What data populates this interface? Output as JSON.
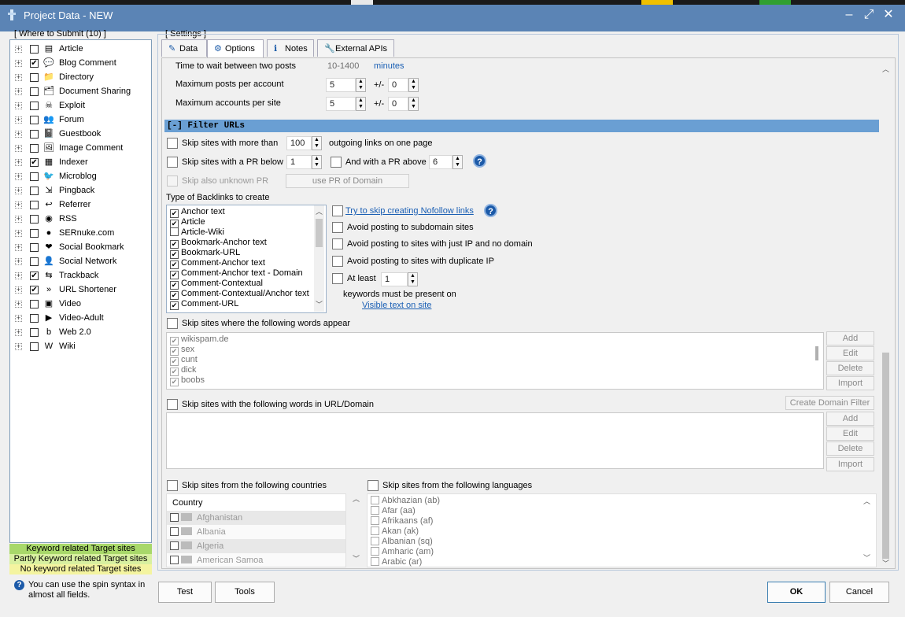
{
  "window": {
    "title": "Project Data - NEW"
  },
  "left": {
    "title": "[ Where to Submit  (10) ]",
    "items": [
      {
        "label": "Article",
        "checked": false,
        "icon": "article-icon",
        "glyph": "▤"
      },
      {
        "label": "Blog Comment",
        "checked": true,
        "icon": "blog-comment-icon",
        "glyph": "💬"
      },
      {
        "label": "Directory",
        "checked": false,
        "icon": "directory-icon",
        "glyph": "📁"
      },
      {
        "label": "Document Sharing",
        "checked": false,
        "icon": "document-sharing-icon",
        "glyph": "🗂"
      },
      {
        "label": "Exploit",
        "checked": false,
        "icon": "exploit-icon",
        "glyph": "☠"
      },
      {
        "label": "Forum",
        "checked": false,
        "icon": "forum-icon",
        "glyph": "👥"
      },
      {
        "label": "Guestbook",
        "checked": false,
        "icon": "guestbook-icon",
        "glyph": "📓"
      },
      {
        "label": "Image Comment",
        "checked": false,
        "icon": "image-comment-icon",
        "glyph": "🖼"
      },
      {
        "label": "Indexer",
        "checked": true,
        "icon": "indexer-icon",
        "glyph": "▦"
      },
      {
        "label": "Microblog",
        "checked": false,
        "icon": "microblog-icon",
        "glyph": "🐦"
      },
      {
        "label": "Pingback",
        "checked": false,
        "icon": "pingback-icon",
        "glyph": "⇲"
      },
      {
        "label": "Referrer",
        "checked": false,
        "icon": "referrer-icon",
        "glyph": "↩"
      },
      {
        "label": "RSS",
        "checked": false,
        "icon": "rss-icon",
        "glyph": "◉"
      },
      {
        "label": "SERnuke.com",
        "checked": false,
        "icon": "sernuke-icon",
        "glyph": "●"
      },
      {
        "label": "Social Bookmark",
        "checked": false,
        "icon": "social-bookmark-icon",
        "glyph": "❤"
      },
      {
        "label": "Social Network",
        "checked": false,
        "icon": "social-network-icon",
        "glyph": "👤"
      },
      {
        "label": "Trackback",
        "checked": true,
        "icon": "trackback-icon",
        "glyph": "⇆"
      },
      {
        "label": "URL Shortener",
        "checked": true,
        "icon": "url-shortener-icon",
        "glyph": "»"
      },
      {
        "label": "Video",
        "checked": false,
        "icon": "video-icon",
        "glyph": "▣"
      },
      {
        "label": "Video-Adult",
        "checked": false,
        "icon": "video-adult-icon",
        "glyph": "▶"
      },
      {
        "label": "Web 2.0",
        "checked": false,
        "icon": "web20-icon",
        "glyph": "b"
      },
      {
        "label": "Wiki",
        "checked": false,
        "icon": "wiki-icon",
        "glyph": "W"
      }
    ],
    "legend": [
      {
        "label": "Keyword related Target sites",
        "color": "#a8d86a"
      },
      {
        "label": "Partly Keyword related Target sites",
        "color": "#d8f0a0"
      },
      {
        "label": "No keyword related Target sites",
        "color": "#f4f4a0"
      }
    ],
    "help_text": "You can use the spin syntax in almost all fields."
  },
  "settings": {
    "title": "[ Settings ]",
    "tabs": [
      {
        "label": "Data",
        "icon": "pencil-icon",
        "glyph": "✎"
      },
      {
        "label": "Options",
        "icon": "gear-icon",
        "glyph": "⚙"
      },
      {
        "label": "Notes",
        "icon": "notes-icon",
        "glyph": "ℹ"
      },
      {
        "label": "External APIs",
        "icon": "wrench-icon",
        "glyph": "🔧"
      }
    ],
    "active_tab": "Options"
  },
  "posting": {
    "wait_label": "Time to wait between two posts",
    "wait_value": "10-1400",
    "wait_unit": "minutes",
    "max_posts_label": "Maximum posts per account",
    "max_posts_value": "5",
    "max_posts_pm": "+/-",
    "max_posts_pm_value": "0",
    "max_accounts_label": "Maximum accounts per site",
    "max_accounts_value": "5",
    "max_accounts_pm": "+/-",
    "max_accounts_pm_value": "0"
  },
  "filter": {
    "header": "[-] Filter URLs",
    "skip_more_label": "Skip sites with more than",
    "skip_more_value": "100",
    "skip_more_suffix": "outgoing links on one page",
    "skip_pr_label": "Skip sites with a PR below",
    "skip_pr_value": "1",
    "pr_above_label": "And with a PR above",
    "pr_above_value": "6",
    "skip_unknown_label": "Skip also unknown PR",
    "use_pr_domain_label": "use PR of Domain",
    "backlinks_label": "Type of Backlinks to create",
    "backlinks": [
      {
        "label": "Anchor text",
        "checked": true
      },
      {
        "label": "Article",
        "checked": true
      },
      {
        "label": "Article-Wiki",
        "checked": false
      },
      {
        "label": "Bookmark-Anchor text",
        "checked": true
      },
      {
        "label": "Bookmark-URL",
        "checked": true
      },
      {
        "label": "Comment-Anchor text",
        "checked": true
      },
      {
        "label": "Comment-Anchor text - Domain",
        "checked": true
      },
      {
        "label": "Comment-Contextual",
        "checked": true
      },
      {
        "label": "Comment-Contextual/Anchor text",
        "checked": true
      },
      {
        "label": "Comment-URL",
        "checked": true
      }
    ],
    "nofollow_link": "Try to skip creating Nofollow links",
    "avoid_subdomain": "Avoid posting to subdomain sites",
    "avoid_ip": "Avoid posting to sites with just IP and no domain",
    "avoid_dup_ip": "Avoid posting to sites with duplicate IP",
    "at_least_label": "At least",
    "at_least_value": "1",
    "keywords_present": "keywords must be present on",
    "visible_text_link": "Visible text on site",
    "skip_words_label": "Skip sites where the following words appear",
    "words": [
      "wikispam.de",
      "sex",
      "cunt",
      "dick",
      "boobs"
    ],
    "skip_url_label": "Skip sites with the following words in URL/Domain",
    "create_domain_filter": "Create Domain Filter",
    "btn_add": "Add",
    "btn_edit": "Edit",
    "btn_delete": "Delete",
    "btn_import": "Import",
    "skip_countries_label": "Skip sites from the following countries",
    "country_header": "Country",
    "countries": [
      "Afghanistan",
      "Albania",
      "Algeria",
      "American Samoa"
    ],
    "skip_languages_label": "Skip sites from the following languages",
    "languages": [
      "Abkhazian (ab)",
      "Afar (aa)",
      "Afrikaans (af)",
      "Akan (ak)",
      "Albanian (sq)",
      "Amharic (am)",
      "Arabic (ar)"
    ]
  },
  "footer": {
    "test": "Test",
    "tools": "Tools",
    "ok": "OK",
    "cancel": "Cancel"
  },
  "colors": {
    "titlebar": "#5b84b5",
    "section_header": "#6a9fd3",
    "link": "#1a5fb4"
  }
}
